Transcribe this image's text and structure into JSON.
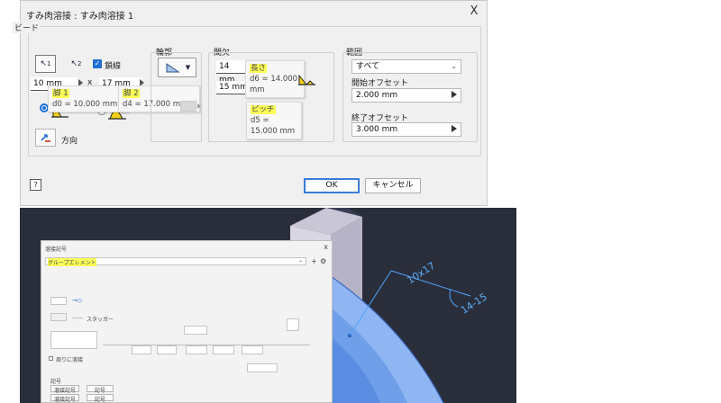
{
  "dialog": {
    "title": "すみ肉溶接 : すみ肉溶接 1",
    "close_glyph": "X",
    "bead": {
      "legend": "ビード",
      "select1_label": "1",
      "select2_label": "2",
      "chain_label": "鎖線",
      "leg1_value": "10 mm",
      "leg2_value": "17 mm",
      "times_sign": "x",
      "leg1_tip_name": "脚 1",
      "leg1_tip_value": "d0 = 10.000 mm",
      "leg2_tip_name": "脚 2",
      "leg2_tip_value": "d4 = 17.000 mm",
      "direction_label": "方向"
    },
    "contour": {
      "label": "輪郭"
    },
    "intermittent": {
      "label": "間欠",
      "length_value": "14 mm",
      "pitch_value": "15 mm",
      "length_tip_name": "長さ",
      "length_tip_value": "d6 = 14.000 mm",
      "pitch_tip_name": "ピッチ",
      "pitch_tip_value": "d5 = 15.000 mm"
    },
    "range": {
      "label": "範囲",
      "selected": "すべて",
      "start_offset_label": "開始オフセット",
      "start_offset_value": "2.000 mm",
      "end_offset_label": "終了オフセット",
      "end_offset_value": "3.000 mm"
    },
    "help_glyph": "?",
    "ok_label": "OK",
    "cancel_label": "キャンセル"
  },
  "viewport": {
    "annotation_left": "10x17",
    "annotation_right": "14-15",
    "accent": "#4da3ff"
  },
  "mini_dialog": {
    "title": "溶接記号",
    "close_glyph": "x",
    "field_value": "グループエレメント",
    "plus_glyph": "+",
    "gear_glyph": "⚙",
    "swap_label": "スタッガー",
    "all_around_label": "周りに溶接",
    "section_label": "記号",
    "btn1": "溶接記号",
    "btn2": "記号",
    "btn3": "溶接記号",
    "btn4": "記号"
  }
}
